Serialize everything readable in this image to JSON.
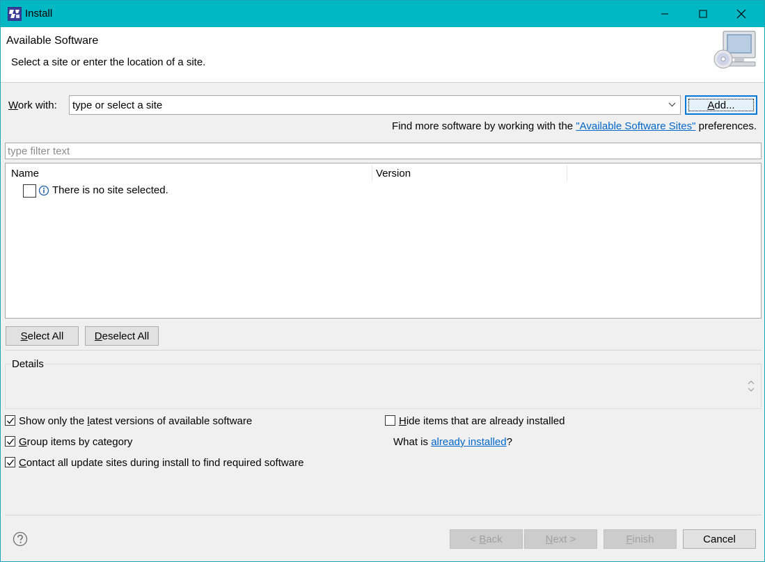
{
  "window": {
    "title": "Install",
    "icons": {
      "app": "eclipse-install-icon",
      "minimize": "minimize-icon",
      "maximize": "maximize-icon",
      "close": "close-icon"
    }
  },
  "banner": {
    "title": "Available Software",
    "description": "Select a site or enter the location of a site.",
    "image": "install-software-computer-icon"
  },
  "work_with": {
    "label_mnemonic": "W",
    "label_rest": "ork with:",
    "value": "type or select a site",
    "add_label_mnemonic": "A",
    "add_label_rest": "dd..."
  },
  "find_more": {
    "prefix": "Find more software by working with the ",
    "link": "\"Available Software Sites\"",
    "suffix": " preferences."
  },
  "filter": {
    "placeholder": "type filter text"
  },
  "tree": {
    "columns": [
      "Name",
      "Version"
    ],
    "rows": [
      {
        "checked": false,
        "icon": "info-icon",
        "text": "There is no site selected."
      }
    ]
  },
  "buttons": {
    "select_all_mnemonic": "S",
    "select_all_rest": "elect All",
    "deselect_all_mnemonic": "D",
    "deselect_all_rest": "eselect All",
    "back_prefix": "< ",
    "back_mnemonic": "B",
    "back_rest": "ack",
    "next_mnemonic": "N",
    "next_rest": "ext >",
    "finish_mnemonic": "F",
    "finish_rest": "inish",
    "cancel": "Cancel"
  },
  "details": {
    "label": "Details"
  },
  "options": {
    "show_latest": {
      "checked": true,
      "pre": "Show only the ",
      "mnemonic": "l",
      "post": "atest versions of available software"
    },
    "group_by_category": {
      "checked": true,
      "pre": "",
      "mnemonic": "G",
      "post": "roup items by category"
    },
    "contact_all": {
      "checked": true,
      "pre": "",
      "mnemonic": "C",
      "post": "ontact all update sites during install to find required software"
    },
    "hide_installed": {
      "checked": false,
      "pre": "",
      "mnemonic": "H",
      "post": "ide items that are already installed"
    },
    "what_is_prefix": "What is ",
    "what_is_link": "already installed",
    "what_is_suffix": "?"
  },
  "help_icon": "help-icon"
}
